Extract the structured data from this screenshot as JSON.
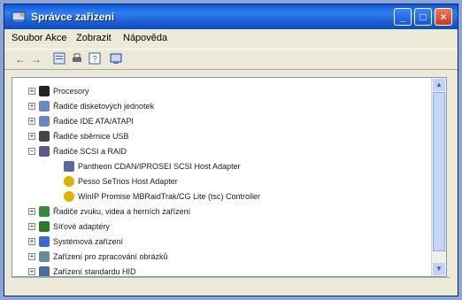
{
  "window": {
    "title": "Správce zařízení"
  },
  "menubar": {
    "items": [
      "Soubor",
      "Akce",
      "Zobrazit",
      "Nápověda"
    ]
  },
  "toolbar": {
    "icons": [
      "back-arrow-icon",
      "forward-arrow-icon",
      "properties-icon",
      "print-icon",
      "help-icon",
      "scan-hardware-icon"
    ]
  },
  "tree": {
    "items": [
      {
        "label": "Procesory",
        "level": 0,
        "expand": "+"
      },
      {
        "label": "Řadiče disketových jednotek",
        "level": 0,
        "expand": "+"
      },
      {
        "label": "Řadiče IDE ATA/ATAPI",
        "level": 0,
        "expand": "+"
      },
      {
        "label": "Řadiče sběrnice USB",
        "level": 0,
        "expand": "+"
      },
      {
        "label": "Řadiče SCSI a RAID",
        "level": 0,
        "expand": "−"
      },
      {
        "label": "Pantheon CDAN/IPROSEI SCSI Host Adapter",
        "level": 1,
        "expand": ""
      },
      {
        "label": "Pesso SeTrios Host Adapter",
        "level": 1,
        "expand": ""
      },
      {
        "label": "WinIP Promise MBRaidTrak/CG Lite (tsc) Controller",
        "level": 1,
        "expand": ""
      },
      {
        "label": "Řadiče zvuku, videa a herních zařízení",
        "level": 0,
        "expand": "+"
      },
      {
        "label": "Síťové adaptéry",
        "level": 0,
        "expand": "+"
      },
      {
        "label": "Systémová zařízení",
        "level": 0,
        "expand": "+"
      },
      {
        "label": "Zařízení pro zpracování obrázků",
        "level": 0,
        "expand": "+"
      },
      {
        "label": "Zařízení standardu HID",
        "level": 0,
        "expand": "+"
      }
    ]
  }
}
